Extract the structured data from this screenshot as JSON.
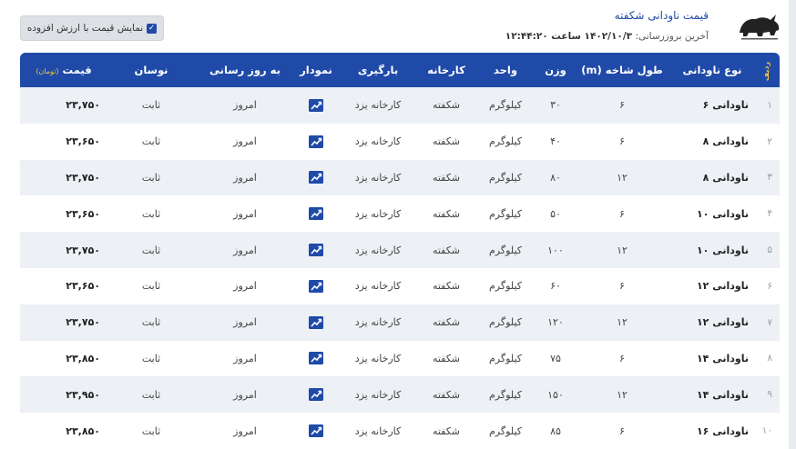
{
  "header": {
    "title": "قیمت ناودانی شکفته",
    "updated_label": "آخرین بروزرسانی:",
    "updated_value": "۱۴۰۲/۱۰/۳ ساعت ۱۲:۴۴:۲۰",
    "logo_icon": "rhino-logo-icon",
    "vat_toggle_label": "نمایش قیمت با ارزش افزوده",
    "vat_checked": true
  },
  "table": {
    "columns": {
      "index": "ردیف",
      "type": "نوع ناودانی",
      "length": "طول شاخه (m)",
      "weight": "وزن",
      "unit": "واحد",
      "factory": "کارخانه",
      "loading": "بارگیری",
      "chart": "نمودار",
      "updated": "به روز رسانی",
      "fluctuation": "نوسان",
      "price": "قیمت",
      "price_unit": "(تومان)"
    },
    "rows": [
      {
        "index": "۱",
        "type": "ناودانی ۶",
        "length": "۶",
        "weight": "۳۰",
        "unit": "کیلوگرم",
        "factory": "شکفته",
        "loading": "کارخانه یزد",
        "updated": "امروز",
        "fluctuation": "ثابت",
        "price": "۲۳,۷۵۰"
      },
      {
        "index": "۲",
        "type": "ناودانی ۸",
        "length": "۶",
        "weight": "۴۰",
        "unit": "کیلوگرم",
        "factory": "شکفته",
        "loading": "کارخانه یزد",
        "updated": "امروز",
        "fluctuation": "ثابت",
        "price": "۲۳,۶۵۰"
      },
      {
        "index": "۳",
        "type": "ناودانی ۸",
        "length": "۱۲",
        "weight": "۸۰",
        "unit": "کیلوگرم",
        "factory": "شکفته",
        "loading": "کارخانه یزد",
        "updated": "امروز",
        "fluctuation": "ثابت",
        "price": "۲۳,۷۵۰"
      },
      {
        "index": "۴",
        "type": "ناودانی ۱۰",
        "length": "۶",
        "weight": "۵۰",
        "unit": "کیلوگرم",
        "factory": "شکفته",
        "loading": "کارخانه یزد",
        "updated": "امروز",
        "fluctuation": "ثابت",
        "price": "۲۳,۶۵۰"
      },
      {
        "index": "۵",
        "type": "ناودانی ۱۰",
        "length": "۱۲",
        "weight": "۱۰۰",
        "unit": "کیلوگرم",
        "factory": "شکفته",
        "loading": "کارخانه یزد",
        "updated": "امروز",
        "fluctuation": "ثابت",
        "price": "۲۳,۷۵۰"
      },
      {
        "index": "۶",
        "type": "ناودانی ۱۲",
        "length": "۶",
        "weight": "۶۰",
        "unit": "کیلوگرم",
        "factory": "شکفته",
        "loading": "کارخانه یزد",
        "updated": "امروز",
        "fluctuation": "ثابت",
        "price": "۲۳,۶۵۰"
      },
      {
        "index": "۷",
        "type": "ناودانی ۱۲",
        "length": "۱۲",
        "weight": "۱۲۰",
        "unit": "کیلوگرم",
        "factory": "شکفته",
        "loading": "کارخانه یزد",
        "updated": "امروز",
        "fluctuation": "ثابت",
        "price": "۲۳,۷۵۰"
      },
      {
        "index": "۸",
        "type": "ناودانی ۱۴",
        "length": "۶",
        "weight": "۷۵",
        "unit": "کیلوگرم",
        "factory": "شکفته",
        "loading": "کارخانه یزد",
        "updated": "امروز",
        "fluctuation": "ثابت",
        "price": "۲۳,۸۵۰"
      },
      {
        "index": "۹",
        "type": "ناودانی ۱۴",
        "length": "۱۲",
        "weight": "۱۵۰",
        "unit": "کیلوگرم",
        "factory": "شکفته",
        "loading": "کارخانه یزد",
        "updated": "امروز",
        "fluctuation": "ثابت",
        "price": "۲۳,۹۵۰"
      },
      {
        "index": "۱۰",
        "type": "ناودانی ۱۶",
        "length": "۶",
        "weight": "۸۵",
        "unit": "کیلوگرم",
        "factory": "شکفته",
        "loading": "کارخانه یزد",
        "updated": "امروز",
        "fluctuation": "ثابت",
        "price": "۲۳,۸۵۰"
      }
    ],
    "chart_icon": "trend-chart-icon"
  },
  "colors": {
    "header_bg": "#1f4aa8",
    "title": "#1f4aa8",
    "price_unit": "#f5c542",
    "row_alt": "#edf0f5",
    "chart_icon": "#1f4aa8"
  }
}
